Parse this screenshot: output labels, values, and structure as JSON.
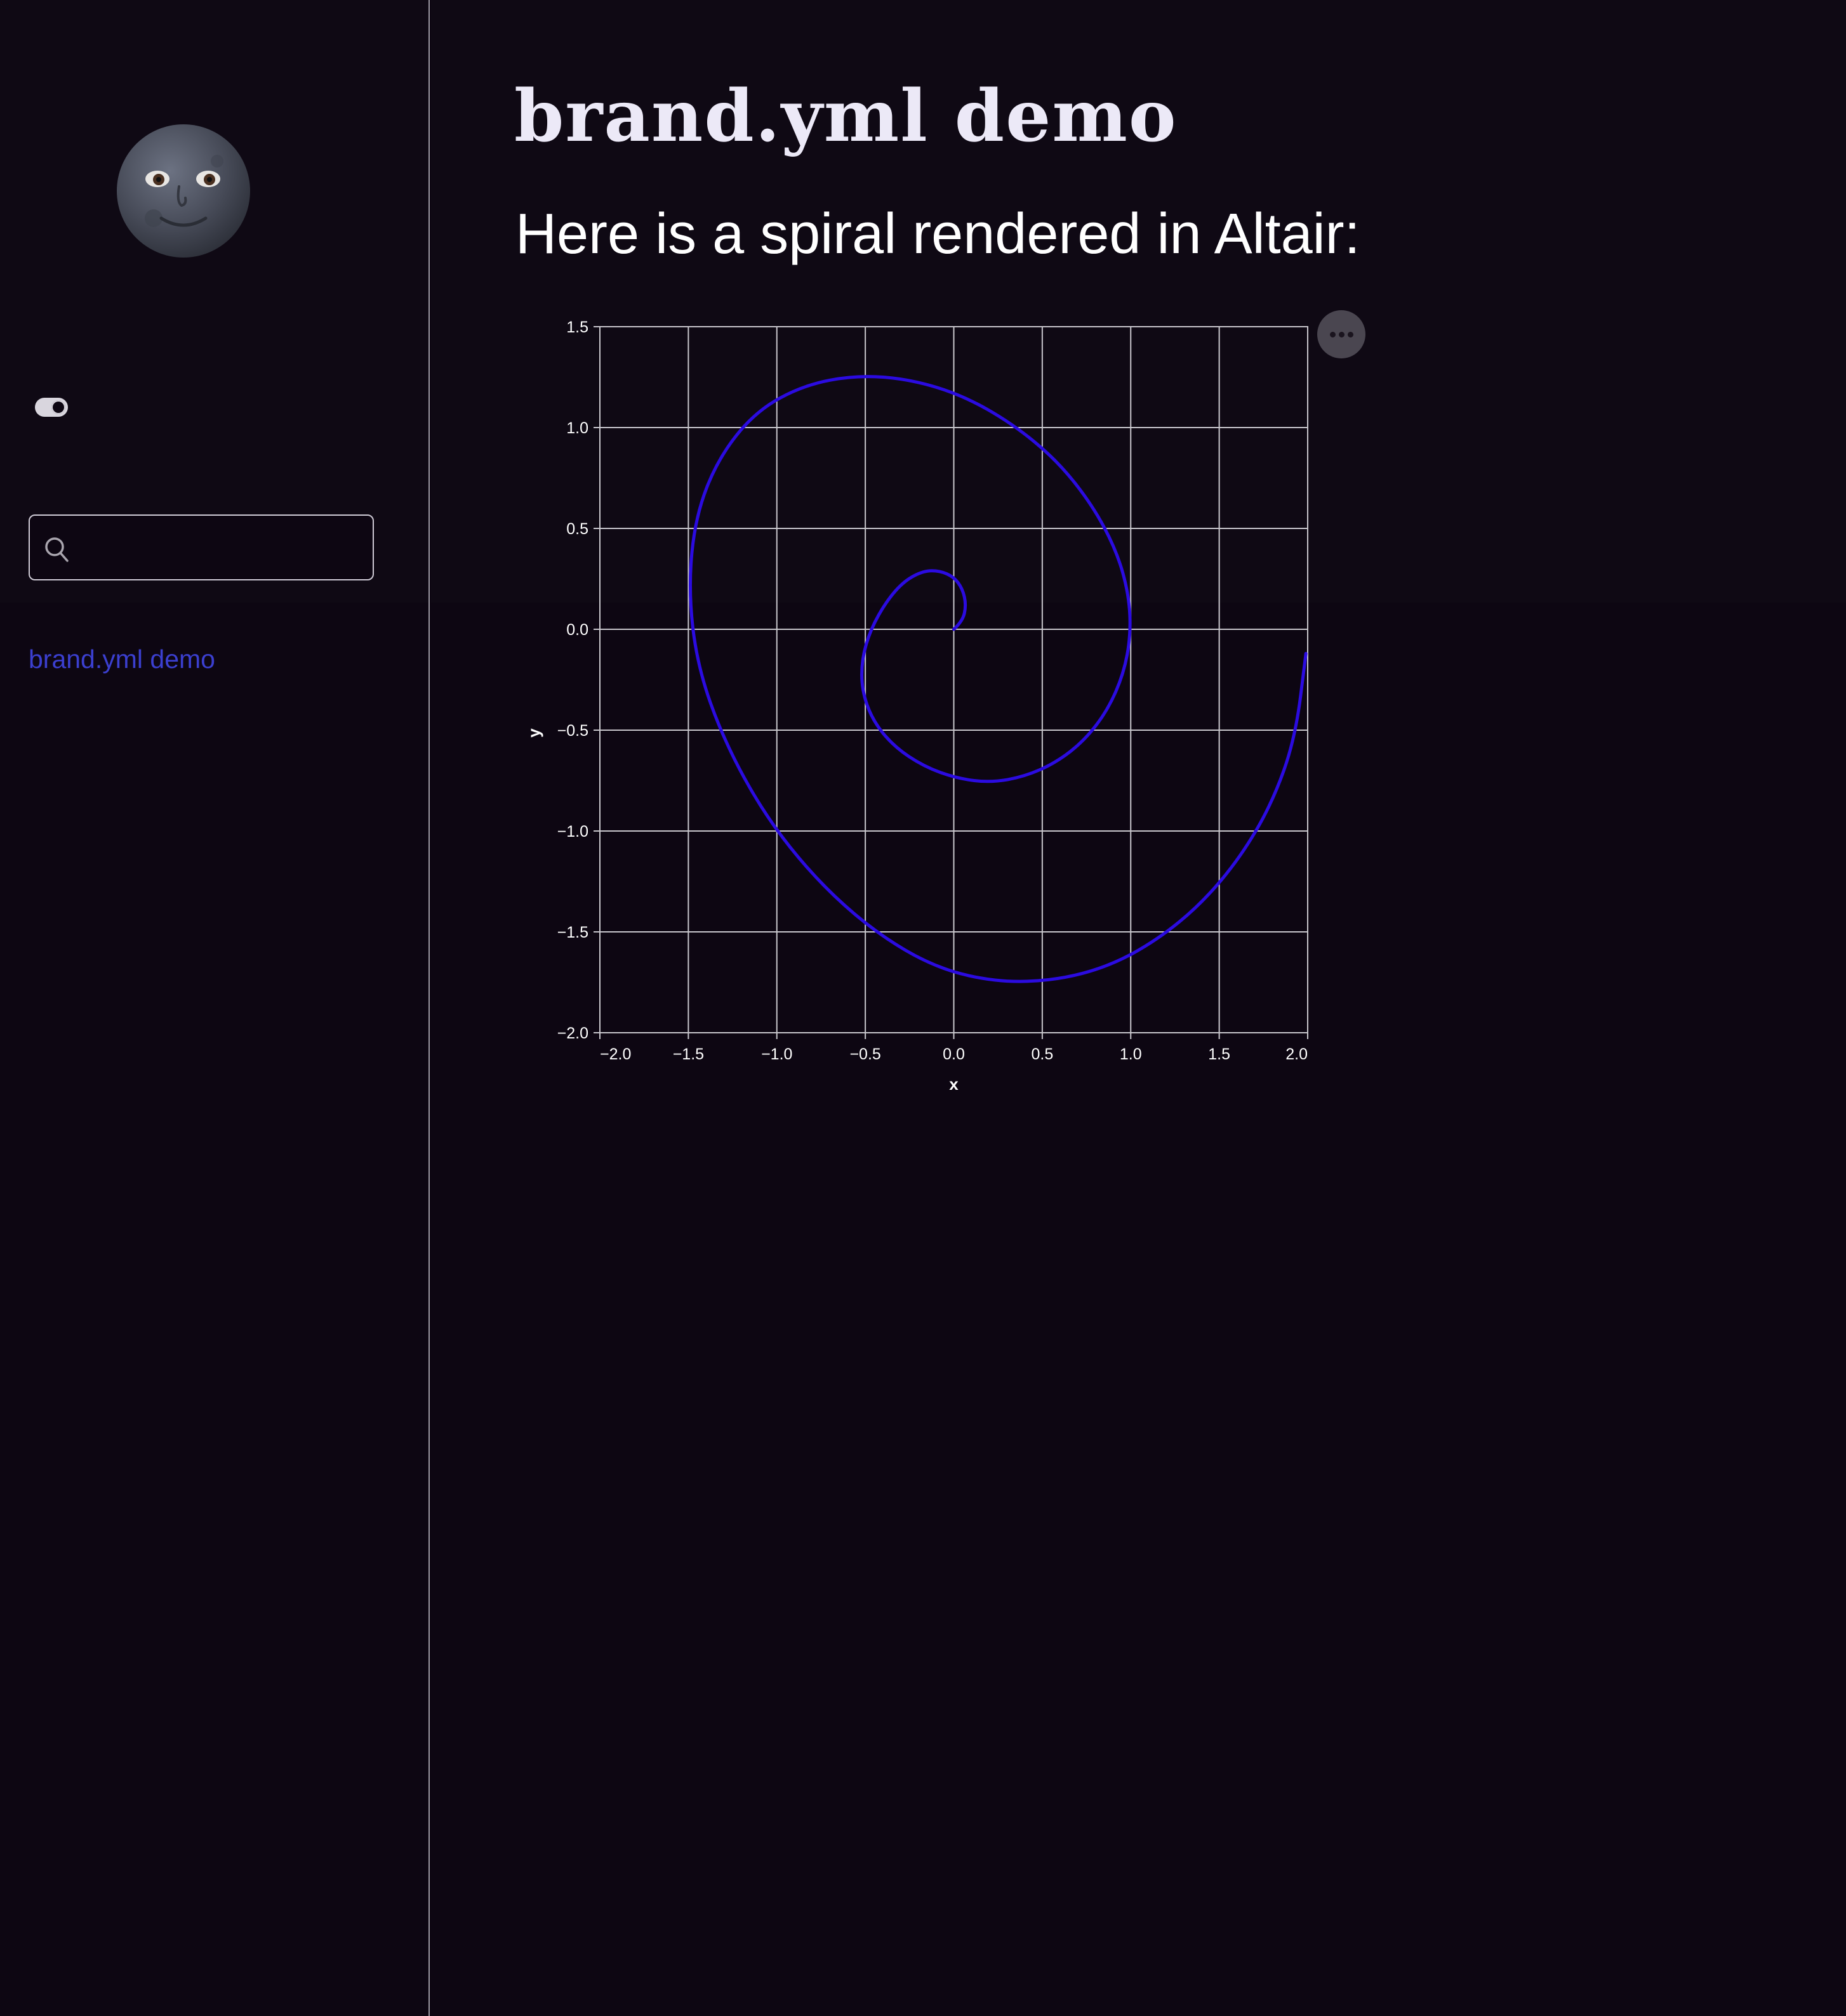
{
  "sidebar": {
    "logo_icon": "new-moon-face-icon",
    "theme_toggle_icon": "toggle-switch-icon",
    "search": {
      "placeholder": "",
      "value": "",
      "icon": "search-icon"
    },
    "nav_items": [
      {
        "label": "brand.yml demo"
      }
    ],
    "link_color": "#3b3fcf"
  },
  "main": {
    "title": "brand.yml demo",
    "intro": "Here is a spiral rendered in Altair:",
    "chart_menu_icon": "more-horizontal-icon"
  },
  "colors": {
    "background": "#0d0612",
    "series": "#2b0be0",
    "grid": "#c8c6cc",
    "text": "#ffffff"
  },
  "chart_data": {
    "type": "line",
    "title": "",
    "xlabel": "x",
    "ylabel": "y",
    "xlim": [
      -2.0,
      2.0
    ],
    "ylim": [
      -2.0,
      1.5
    ],
    "x_ticks": [
      "−2.0",
      "−1.5",
      "−1.0",
      "−0.5",
      "0.0",
      "0.5",
      "1.0",
      "1.5",
      "2.0"
    ],
    "y_ticks": [
      "1.5",
      "1.0",
      "0.5",
      "0.0",
      "−0.5",
      "−1.0",
      "−1.5",
      "−2.0"
    ],
    "grid": true,
    "series": [
      {
        "color": "#2b0be0",
        "x": [
          0.0,
          0.05,
          0.07,
          0.05,
          0.0,
          -0.08,
          -0.17,
          -0.28,
          -0.38,
          -0.47,
          -0.52,
          -0.52,
          -0.46,
          -0.34,
          -0.17,
          0.02,
          0.21,
          0.4,
          0.58,
          0.74,
          0.87,
          0.96,
          1.0,
          0.99,
          0.92,
          0.78,
          0.58,
          0.33,
          0.05,
          -0.25,
          -0.55,
          -0.85,
          -1.12,
          -1.33,
          -1.46,
          -1.5,
          -1.45,
          -1.3,
          -1.07,
          -0.78,
          -0.45,
          -0.1,
          0.25,
          0.58,
          0.88,
          1.15,
          1.4,
          1.62,
          1.8,
          1.93,
          1.99
        ],
        "y": [
          0.0,
          0.04,
          0.12,
          0.2,
          0.26,
          0.29,
          0.29,
          0.24,
          0.14,
          0.0,
          -0.15,
          -0.3,
          -0.45,
          -0.58,
          -0.68,
          -0.74,
          -0.76,
          -0.73,
          -0.66,
          -0.55,
          -0.4,
          -0.22,
          -0.03,
          0.17,
          0.39,
          0.62,
          0.84,
          1.02,
          1.16,
          1.24,
          1.26,
          1.21,
          1.08,
          0.85,
          0.56,
          0.2,
          -0.18,
          -0.55,
          -0.92,
          -1.24,
          -1.5,
          -1.68,
          -1.75,
          -1.74,
          -1.67,
          -1.54,
          -1.36,
          -1.13,
          -0.86,
          -0.54,
          -0.12
        ]
      }
    ]
  }
}
